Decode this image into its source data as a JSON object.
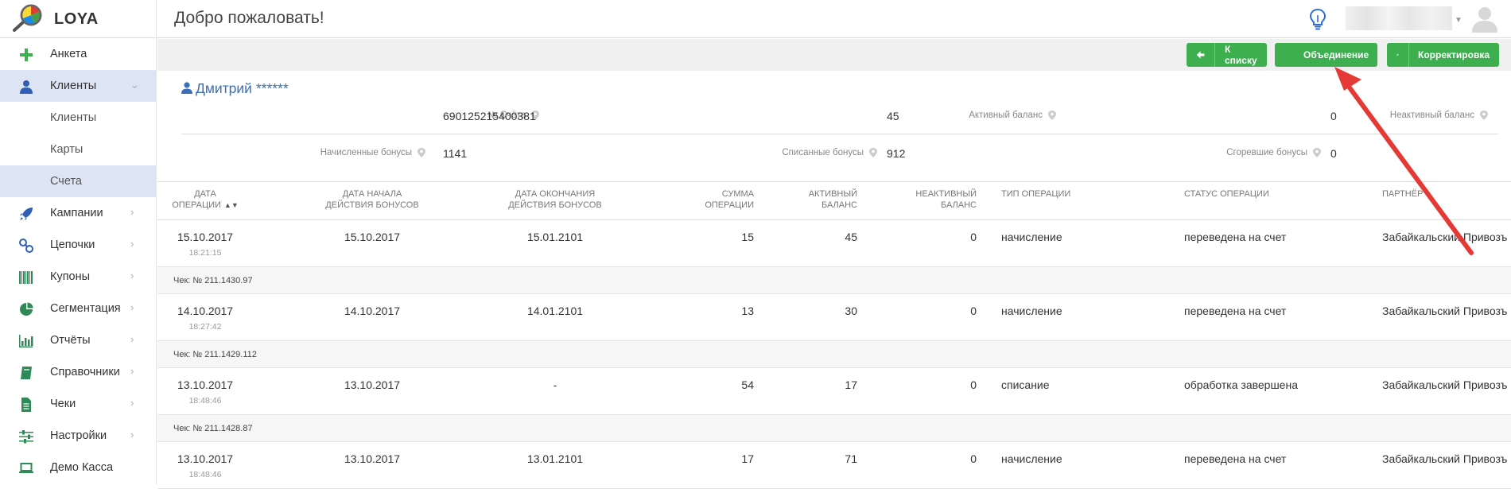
{
  "app": {
    "name": "LOYA"
  },
  "header": {
    "title": "Добро пожаловать!"
  },
  "sidebar": {
    "items": [
      {
        "label": "Анкета",
        "icon": "plus-icon"
      },
      {
        "label": "Клиенты",
        "icon": "user-icon"
      },
      {
        "label": "Клиенты",
        "icon": ""
      },
      {
        "label": "Карты",
        "icon": ""
      },
      {
        "label": "Счета",
        "icon": ""
      },
      {
        "label": "Кампании",
        "icon": "rocket-icon"
      },
      {
        "label": "Цепочки",
        "icon": "chain-icon"
      },
      {
        "label": "Купоны",
        "icon": "barcode-icon"
      },
      {
        "label": "Сегментация",
        "icon": "pie-icon"
      },
      {
        "label": "Отчёты",
        "icon": "bar-chart-icon"
      },
      {
        "label": "Справочники",
        "icon": "book-icon"
      },
      {
        "label": "Чеки",
        "icon": "file-icon"
      },
      {
        "label": "Настройки",
        "icon": "sliders-icon"
      },
      {
        "label": "Демо Касса",
        "icon": "laptop-icon"
      }
    ]
  },
  "toolbar": {
    "back_label": "К списку",
    "merge_label": "Объединение",
    "edit_label": "Корректировка"
  },
  "client": {
    "name": "Дмитрий ******",
    "account_label": "№ Счёта",
    "account_value": "690125215400381",
    "active_label": "Активный баланс",
    "active_value": "45",
    "inactive_label": "Неактивный баланс",
    "inactive_value": "0",
    "accrued_label": "Начисленные бонусы",
    "accrued_value": "1141",
    "spent_label": "Списанные бонусы",
    "spent_value": "912",
    "burned_label": "Сгоревшие бонусы",
    "burned_value": "0"
  },
  "table": {
    "headers": {
      "date": [
        "ДАТА",
        "ОПЕРАЦИИ"
      ],
      "start": [
        "ДАТА НАЧАЛА",
        "ДЕЙСТВИЯ БОНУСОВ"
      ],
      "end": [
        "ДАТА ОКОНЧАНИЯ",
        "ДЕЙСТВИЯ БОНУСОВ"
      ],
      "sum": [
        "СУММА",
        "ОПЕРАЦИИ"
      ],
      "active": [
        "АКТИВНЫЙ",
        "БАЛАНС"
      ],
      "inactive": [
        "НЕАКТИВНЫЙ",
        "БАЛАНС"
      ],
      "type": "ТИП ОПЕРАЦИИ",
      "status": "СТАТУС ОПЕРАЦИИ",
      "partner": "ПАРТНЁР"
    },
    "rows": [
      {
        "date": "15.10.2017",
        "time": "18:21:15",
        "start": "15.10.2017",
        "end": "15.01.2101",
        "sum": "15",
        "active": "45",
        "inactive": "0",
        "type": "начисление",
        "status": "переведена на счет",
        "partner": "Забайкальский Привозъ",
        "check": "Чек: № 211.1430.97"
      },
      {
        "date": "14.10.2017",
        "time": "18:27:42",
        "start": "14.10.2017",
        "end": "14.01.2101",
        "sum": "13",
        "active": "30",
        "inactive": "0",
        "type": "начисление",
        "status": "переведена на счет",
        "partner": "Забайкальский Привозъ",
        "check": "Чек: № 211.1429.112"
      },
      {
        "date": "13.10.2017",
        "time": "18:48:46",
        "start": "13.10.2017",
        "end": "-",
        "sum": "54",
        "active": "17",
        "inactive": "0",
        "type": "списание",
        "status": "обработка завершена",
        "partner": "Забайкальский Привозъ",
        "check": "Чек: № 211.1428.87"
      },
      {
        "date": "13.10.2017",
        "time": "18:48:46",
        "start": "13.10.2017",
        "end": "13.01.2101",
        "sum": "17",
        "active": "71",
        "inactive": "0",
        "type": "начисление",
        "status": "переведена на счет",
        "partner": "Забайкальский Привозъ",
        "check": ""
      }
    ]
  },
  "colors": {
    "accent_green": "#3daf4f",
    "link_blue": "#3b6fb6",
    "active_nav": "#dde4f4",
    "annotation_red": "#e53935"
  }
}
